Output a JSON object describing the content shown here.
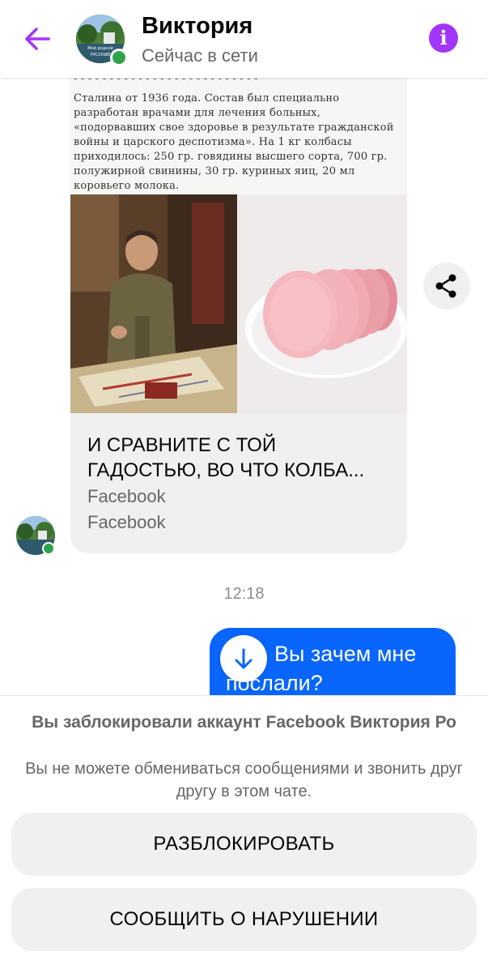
{
  "header": {
    "contact_name": "Виктория",
    "status": "Сейчас в сети",
    "avatar_caption_line1": "Мой родной",
    "avatar_caption_line2": "РУССКИЙ"
  },
  "shared_post": {
    "scan_lines": [
      "Сталина от 1936 года. Состав был специально",
      "разработан врачами для лечения больных,",
      "«подорвавших свое здоровье в результате гражданской",
      "войны и царского деспотизма». На 1 кг колбасы",
      "приходилось: 250 гр. говядины высшего сорта, 700 гр.",
      "полужирной свинины, 30 гр. куриных яиц, 20 мл",
      "коровьего молока."
    ],
    "title_line1": "И СРАВНИТЕ С ТОЙ",
    "title_line2": "ГАДОСТЬЮ, ВО ЧТО КОЛБА...",
    "source": "Facebook",
    "subsource": "Facebook"
  },
  "timestamp": "12:18",
  "outgoing_message": "Вы зачем мне послали?",
  "blocked_panel": {
    "title": "Вы заблокировали аккаунт Facebook Виктория Ро",
    "description": "Вы не можете обмениваться сообщениями и звонить друг другу в этом чате.",
    "unblock_label": "РАЗБЛОКИРОВАТЬ",
    "report_label": "СООБЩИТЬ О НАРУШЕНИИ"
  },
  "icons": {
    "back": "arrow-left-icon",
    "info": "info-icon",
    "share": "share-icon",
    "scroll": "arrow-down-icon"
  },
  "colors": {
    "accent": "#a334fa",
    "bubble": "#0866ff",
    "online": "#31a24c",
    "muted": "#65676b"
  }
}
